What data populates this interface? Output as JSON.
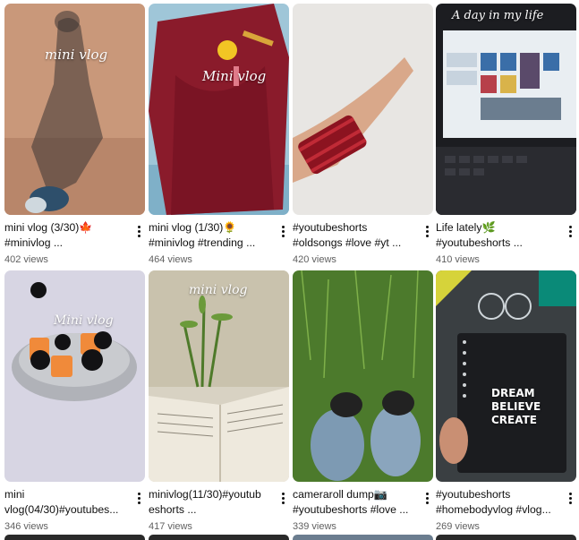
{
  "videos": [
    {
      "title": "mini vlog (3/30)🍁 #minivlog ...",
      "views": "402 views",
      "overlay": "mini vlog"
    },
    {
      "title": "mini vlog (1/30)🌻 #minivlog #trending ...",
      "views": "464 views",
      "overlay": "Mini vlog"
    },
    {
      "title": "#youtubeshorts #oldsongs #love #yt ...",
      "views": "420 views",
      "overlay": ""
    },
    {
      "title": "Life lately🌿 #youtubeshorts ...",
      "views": "410 views",
      "overlay": "A day in my life"
    },
    {
      "title": "mini vlog(04/30)#youtubes...",
      "views": "346 views",
      "overlay": "Mini vlog"
    },
    {
      "title": "minivlog(11/30)#youtub eshorts ...",
      "views": "417 views",
      "overlay": "mini vlog"
    },
    {
      "title": "cameraroll dump📷 #youtubeshorts #love ...",
      "views": "339 views",
      "overlay": ""
    },
    {
      "title": "#youtubeshorts #homebodyvlog #vlog...",
      "views": "269 views",
      "overlay": "DREAM BELIEVE CREATE"
    }
  ],
  "icons": {
    "more": "vertical-ellipsis-icon"
  }
}
